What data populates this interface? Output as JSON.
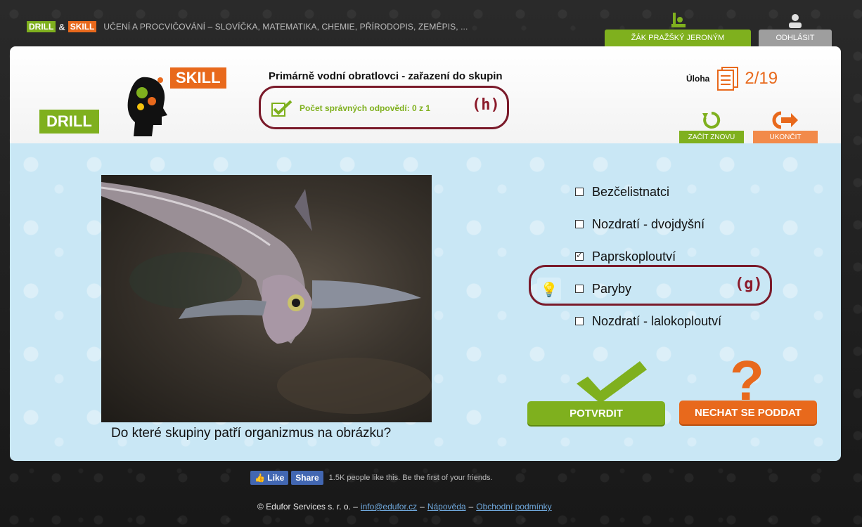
{
  "topbar": {
    "drill": "DRILL",
    "amp": "&",
    "skill": "SKILL",
    "description": "UČENÍ A PROCVIČOVÁNÍ – SLOVÍČKA, MATEMATIKA, CHEMIE, PŘÍRODOPIS, ZEMĚPIS, ...",
    "user_label": "ŽÁK PRAŽŠKÝ JERONÝM",
    "logout_label": "ODHLÁSIT"
  },
  "logo": {
    "drill": "DRILL",
    "skill": "SKILL"
  },
  "header": {
    "title": "Primárně vodní obratlovci - zařazení do skupin",
    "score_text": "Počet správných odpovědí: 0 z 1",
    "annotation_h": "(h)",
    "task_label": "Úloha",
    "task_count": "2/19",
    "restart_label": "ZAČÍT ZNOVU",
    "end_label": "UKONČIT"
  },
  "main": {
    "question": "Do které skupiny patří organizmus na obrázku?",
    "options": [
      {
        "label": "Bezčelistnatci",
        "checked": false
      },
      {
        "label": "Nozdratí - dvojdyšní",
        "checked": false
      },
      {
        "label": "Paprskoploutví",
        "checked": true
      },
      {
        "label": "Paryby",
        "checked": false
      },
      {
        "label": "Nozdratí - lalokoploutví",
        "checked": false
      }
    ],
    "annotation_g": "(g)",
    "confirm_label": "POTVRDIT",
    "giveup_label": "NECHAT SE PODDAT"
  },
  "footer": {
    "like": "Like",
    "share": "Share",
    "fb_text": "1.5K people like this. Be the first of your friends.",
    "copyright": "© Edufor Services s. r. o. –",
    "email": "info@edufor.cz",
    "sep1": "–",
    "help": "Nápověda",
    "sep2": "–",
    "terms": "Obchodní podmínky"
  },
  "colors": {
    "green": "#7fb01e",
    "orange": "#e8691c",
    "annotation": "#7a1a2a",
    "panel_blue": "#c9e7f5"
  }
}
